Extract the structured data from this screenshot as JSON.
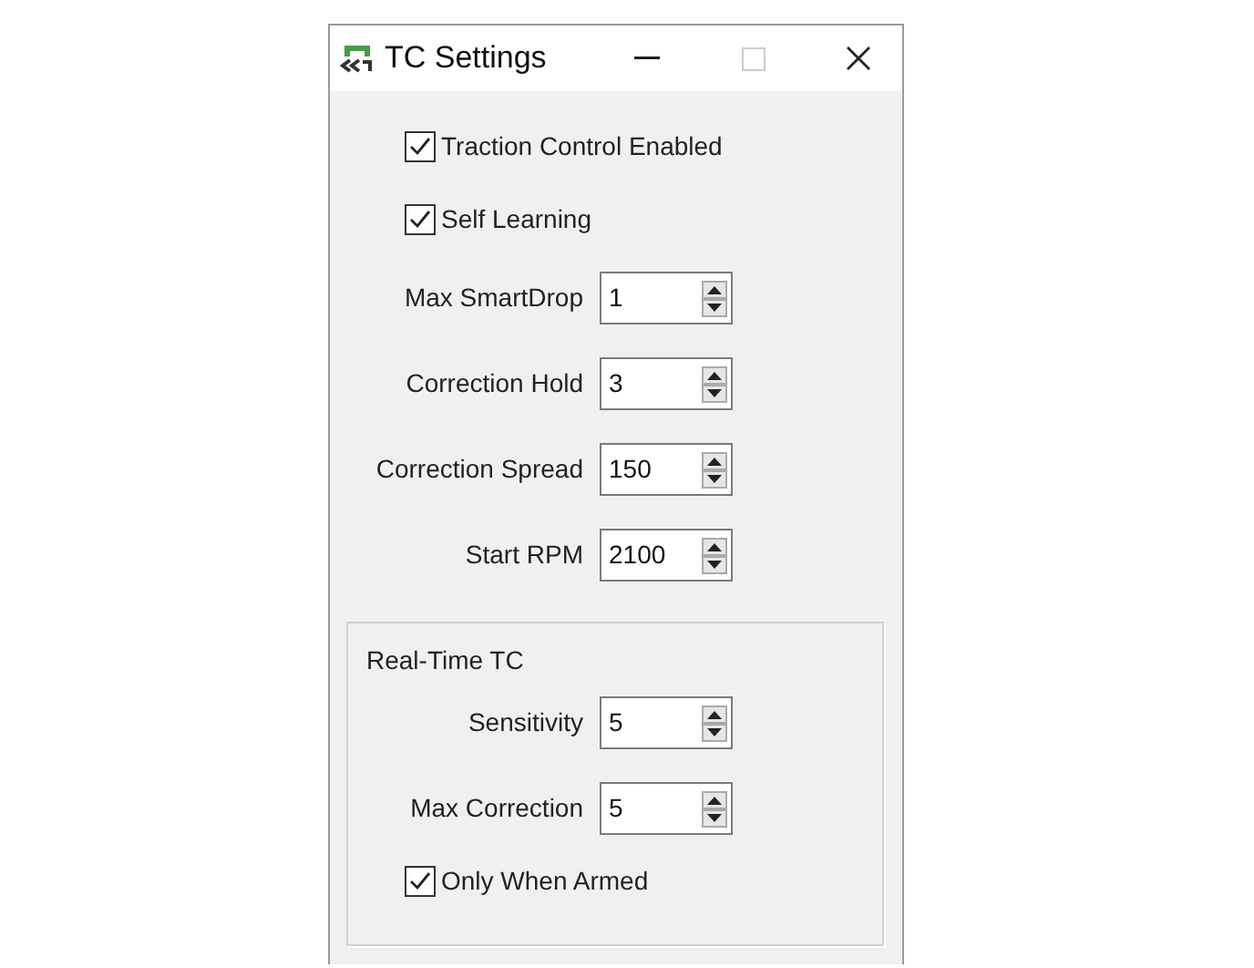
{
  "window": {
    "title": "TC Settings"
  },
  "options": [
    {
      "label": "Traction Control Enabled",
      "checked": true
    },
    {
      "label": "Self Learning",
      "checked": true
    }
  ],
  "fields": [
    {
      "label": "Max SmartDrop",
      "value": "1"
    },
    {
      "label": "Correction Hold",
      "value": "3"
    },
    {
      "label": "Correction Spread",
      "value": "150"
    },
    {
      "label": "Start RPM",
      "value": "2100"
    }
  ],
  "group": {
    "title": "Real-Time TC",
    "fields": [
      {
        "label": "Sensitivity",
        "value": "5"
      },
      {
        "label": "Max Correction",
        "value": "5"
      }
    ],
    "options": [
      {
        "label": "Only When Armed",
        "checked": true
      }
    ]
  }
}
